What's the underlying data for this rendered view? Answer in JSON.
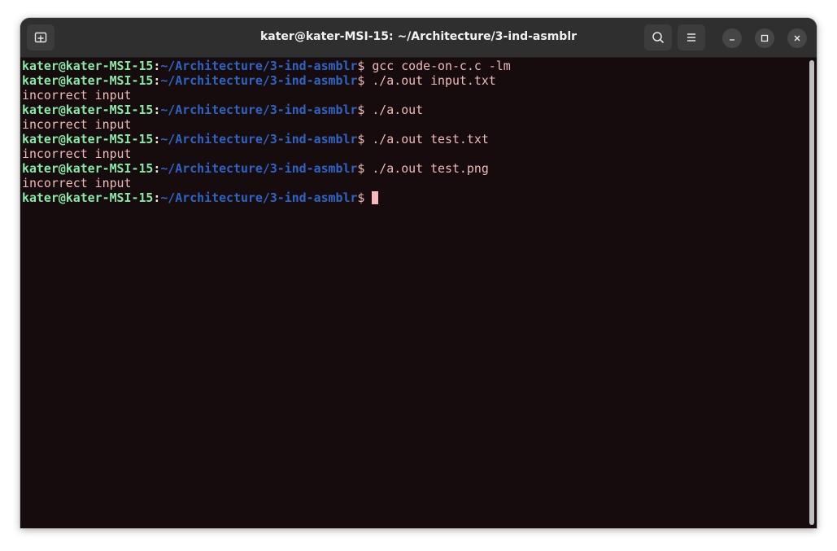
{
  "window": {
    "title": "kater@kater-MSI-15: ~/Architecture/3-ind-asmblr"
  },
  "toolbar": {
    "new_tab_icon": "new-tab-icon",
    "search_icon": "search-icon",
    "menu_icon": "hamburger-menu-icon",
    "minimize_icon": "minimize-icon",
    "maximize_icon": "maximize-icon",
    "close_icon": "close-icon"
  },
  "colors": {
    "prompt_user": "#8ae9a6",
    "prompt_path": "#2f64c4",
    "text": "#f0bcb8",
    "background": "#160c0e",
    "cursor": "#f7b9b9"
  },
  "terminal": {
    "prompt": {
      "user_host": "kater@kater-MSI-15",
      "colon": ":",
      "path": "~/Architecture/3-ind-asmblr",
      "dollar": "$ "
    },
    "lines": [
      {
        "type": "cmd",
        "text": "gcc code-on-c.c -lm"
      },
      {
        "type": "cmd",
        "text": "./a.out input.txt"
      },
      {
        "type": "out",
        "text": "incorrect input"
      },
      {
        "type": "cmd",
        "text": "./a.out"
      },
      {
        "type": "out",
        "text": "incorrect input"
      },
      {
        "type": "cmd",
        "text": "./a.out test.txt"
      },
      {
        "type": "out",
        "text": "incorrect input"
      },
      {
        "type": "cmd",
        "text": "./a.out test.png"
      },
      {
        "type": "out",
        "text": "incorrect input"
      },
      {
        "type": "cmd",
        "text": "",
        "cursor": true
      }
    ]
  }
}
